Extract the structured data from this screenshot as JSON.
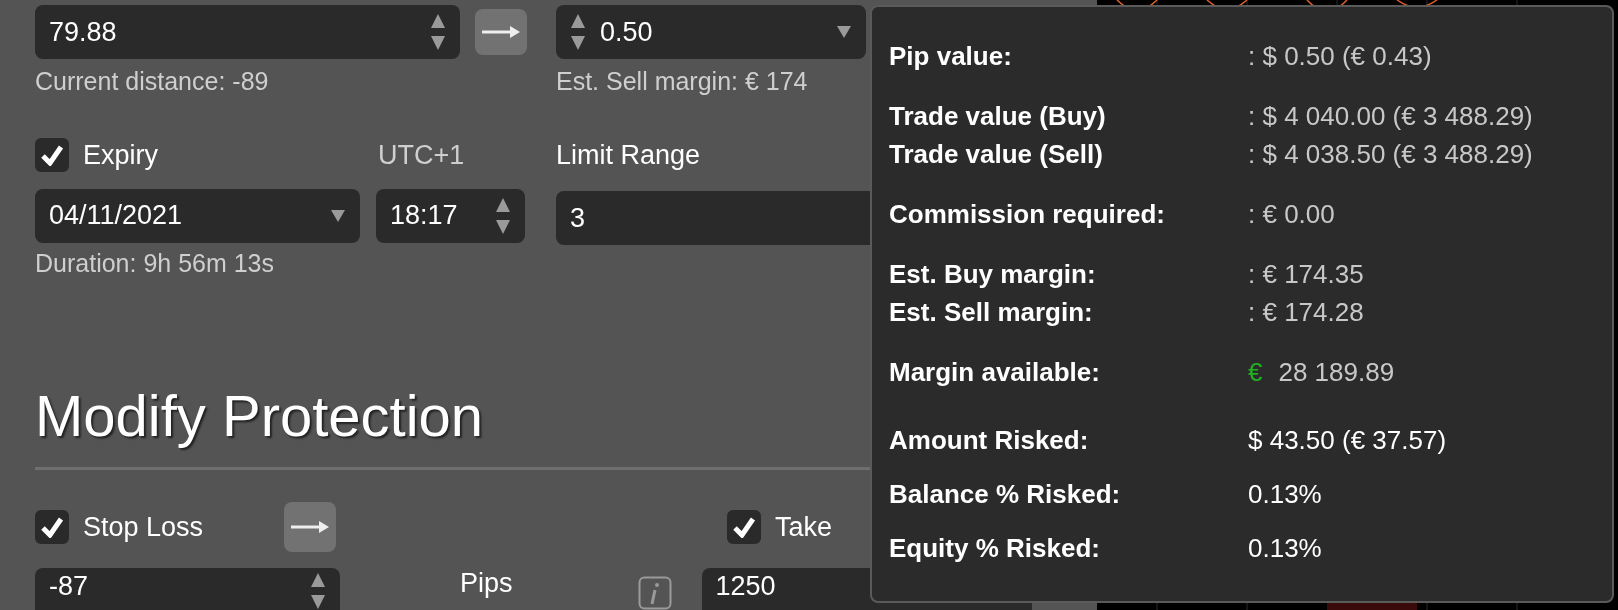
{
  "order_form": {
    "price_field": {
      "value": "79.88"
    },
    "current_distance": "Current distance: -89",
    "amount_select": {
      "value": "0.50"
    },
    "sell_margin_text": "Est. Sell margin: € 174",
    "expiry": {
      "label": "Expiry",
      "checked": true
    },
    "timezone": "UTC+1",
    "date_select": {
      "value": "04/11/2021"
    },
    "time_field": {
      "value": "18:17"
    },
    "duration": "Duration: 9h 56m 13s",
    "limit_range": {
      "label": "Limit Range",
      "value": "3"
    }
  },
  "protection": {
    "title": "Modify Protection",
    "stop_loss": {
      "label": "Stop Loss",
      "checked": true,
      "value": "-87"
    },
    "unit": "Pips",
    "take_profit": {
      "label": "Take",
      "checked": true,
      "value": "1250"
    }
  },
  "tooltip": {
    "groups": [
      [
        {
          "label": "Pip value:",
          "kind": "muted",
          "value": ": $ 0.50 (€ 0.43)"
        }
      ],
      [
        {
          "label": "Trade value (Buy)",
          "kind": "muted",
          "value": ": $ 4 040.00 (€ 3 488.29)"
        },
        {
          "label": "Trade value (Sell)",
          "kind": "muted",
          "value": ": $ 4 038.50 (€ 3 488.29)"
        }
      ],
      [
        {
          "label": "Commission required:",
          "kind": "muted",
          "value": ": € 0.00"
        }
      ],
      [
        {
          "label": "Est. Buy margin:",
          "kind": "muted",
          "value": ": € 174.35"
        },
        {
          "label": "Est. Sell margin:",
          "kind": "muted",
          "value": ": € 174.28"
        }
      ],
      [
        {
          "label": "Margin available:",
          "kind": "currency",
          "symbol": "€",
          "value": "28 189.89"
        }
      ],
      [
        {
          "label": "Amount Risked:",
          "kind": "plain",
          "value": "$ 43.50 (€ 37.57)"
        },
        {
          "label": "Balance % Risked:",
          "kind": "plain",
          "value": "0.13%"
        },
        {
          "label": "Equity % Risked:",
          "kind": "plain",
          "value": "0.13%"
        }
      ]
    ]
  }
}
